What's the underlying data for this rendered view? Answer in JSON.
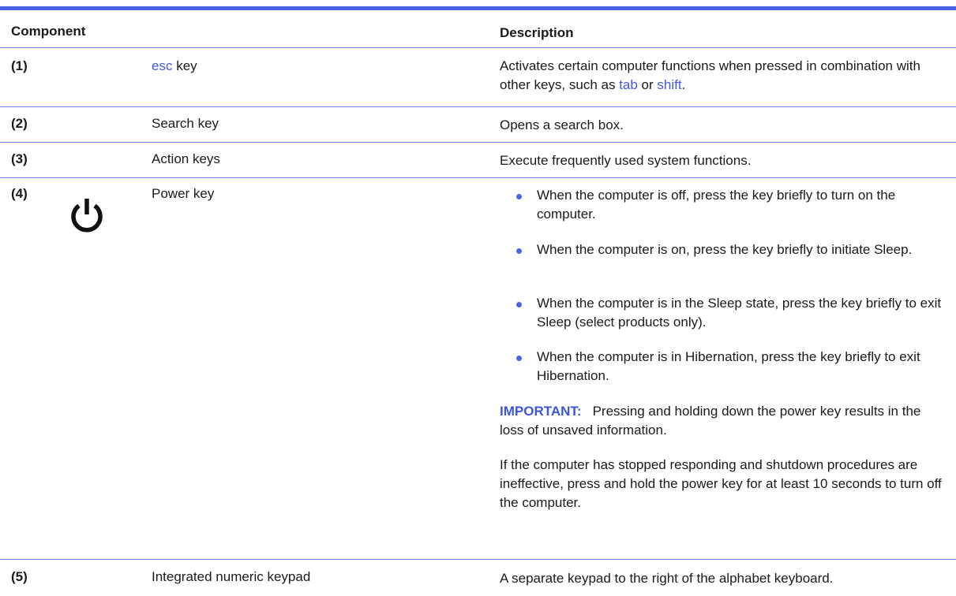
{
  "table": {
    "headers": {
      "component": "Component",
      "description": "Description"
    },
    "rows": [
      {
        "number": "(1)",
        "name_link": "esc",
        "name_rest": " key",
        "desc_part1": "Activates certain computer functions when pressed in combination with other keys, such as ",
        "desc_link1": "tab",
        "desc_part2": " or ",
        "desc_link2": "shift",
        "desc_part3": "."
      },
      {
        "number": "(2)",
        "name": "Search key",
        "description": "Opens a search box."
      },
      {
        "number": "(3)",
        "name": "Action keys",
        "description": "Execute frequently used system functions."
      },
      {
        "number": "(4)",
        "icon": "power-icon",
        "name": "Power key",
        "bullets": [
          "When the computer is off, press the key briefly to turn on the computer.",
          "When the computer is on, press the key briefly to initiate Sleep.",
          "When the computer is in the Sleep state, press the key briefly to exit Sleep (select products only).",
          "When the computer is in Hibernation, press the key briefly to exit Hibernation."
        ],
        "important_label": "IMPORTANT:",
        "important_text": "Pressing and holding down the power key results in the loss of unsaved information.",
        "note": "If the computer has stopped responding and shutdown procedures are ineffective, press and hold the power key for at least 10 seconds to turn off the computer."
      },
      {
        "number": "(5)",
        "name": "Integrated numeric keypad",
        "description": "A separate keypad to the right of the alphabet keyboard."
      }
    ]
  },
  "colors": {
    "accent": "#4a63e8",
    "link": "#4258e0"
  }
}
